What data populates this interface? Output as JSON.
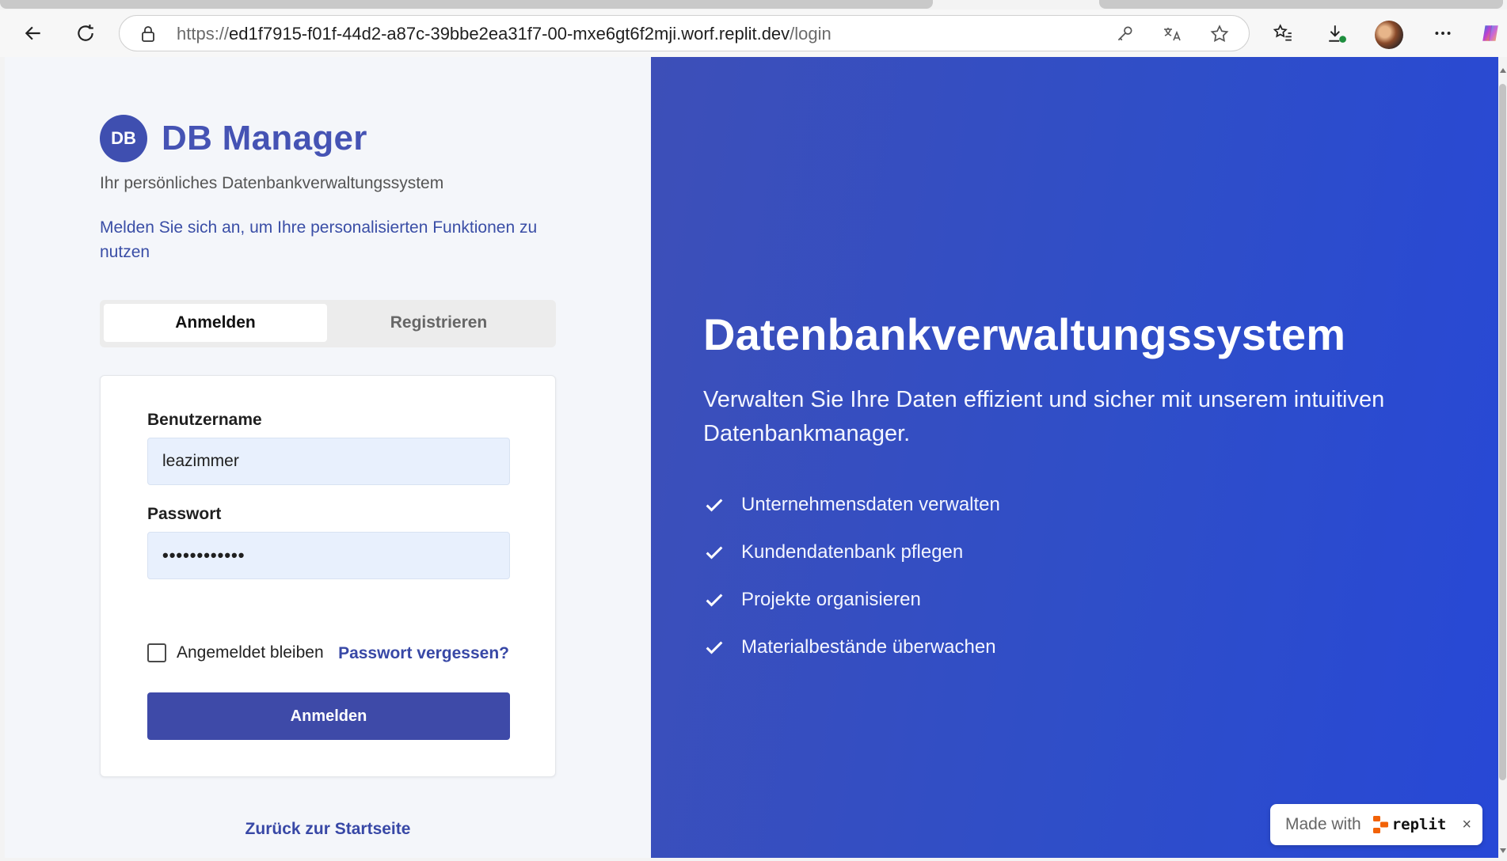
{
  "browser": {
    "url_prefix": "https://",
    "url_host": "ed1f7915-f01f-44d2-a87c-39bbe2ea31f7-00-mxe6gt6f2mji.worf.replit.dev",
    "url_path": "/login",
    "icons": [
      "back-arrow-icon",
      "refresh-icon",
      "lock-icon",
      "key-icon",
      "translate-icon",
      "star-icon",
      "favorites-icon",
      "download-icon",
      "profile-avatar",
      "more-icon",
      "copilot-icon"
    ]
  },
  "brand": {
    "logo_text": "DB",
    "name": "DB Manager",
    "subtitle": "Ihr persönliches Datenbankverwaltungssystem",
    "intro": "Melden Sie sich an, um Ihre personalisierten Funktionen zu nutzen"
  },
  "tabs": {
    "login": "Anmelden",
    "register": "Registrieren",
    "active": "login"
  },
  "form": {
    "username_label": "Benutzername",
    "username_value": "leazimmer",
    "password_label": "Passwort",
    "password_value": "••••••••••••",
    "remember_label": "Angemeldet bleiben",
    "remember_checked": false,
    "forgot_link": "Passwort vergessen?",
    "submit_label": "Anmelden"
  },
  "back_link": "Zurück zur Startseite",
  "hero": {
    "title": "Datenbankverwaltungssystem",
    "text": "Verwalten Sie Ihre Daten effizient und sicher mit unserem intuitiven Datenbankmanager.",
    "features": [
      "Unternehmensdaten verwalten",
      "Kundendatenbank pflegen",
      "Projekte organisieren",
      "Materialbestände überwachen"
    ]
  },
  "badge": {
    "made_with": "Made with",
    "brand": "replit",
    "close": "×"
  },
  "colors": {
    "accent": "#3e4aa8",
    "hero_bg": "#2f4ec8",
    "input_bg": "#e8f0fd"
  }
}
